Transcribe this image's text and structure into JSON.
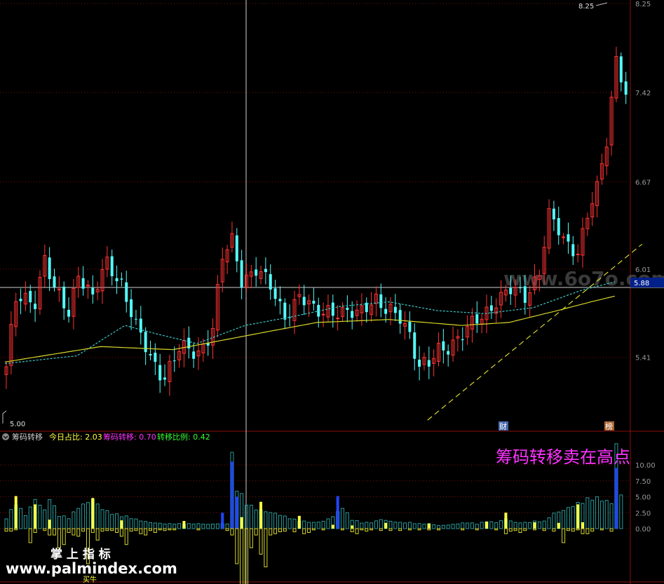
{
  "main": {
    "price_ticks": [
      "8.25",
      "7.42",
      "6.67",
      "6.01",
      "5.41"
    ],
    "current_price": "5.88",
    "high_label": "8.25",
    "low_label": "5.00",
    "badge_cai": "财",
    "badge_bang": "榜",
    "watermark": "www.6o7o.com"
  },
  "sub": {
    "title": "筹码转移",
    "legend_1": "今日占比: 2.03",
    "legend_2": "筹码转移: 0.70",
    "legend_3": "转移比例: 0.42",
    "annotation": "筹码转移卖在高点",
    "ticks": [
      "10.00",
      "7.50",
      "5.00",
      "2.50",
      "0.00"
    ],
    "logo_title": "掌 上 指 标",
    "site": "www.palmindex.com",
    "bottom_label": "买牛"
  },
  "colors": {
    "up": "#ff3232",
    "down": "#54fcfc",
    "ma_short": "#3ec8c8",
    "ma_long": "#d6d62a",
    "yellow": "#ffff44",
    "blue": "#2244ff",
    "magenta": "#ff33ff",
    "green": "#33ff33",
    "axis_highlight": "#00208a"
  },
  "chart_data": [
    {
      "type": "candlestick",
      "y_scale": "log",
      "y_ticks": [
        8.25,
        7.42,
        6.67,
        6.01,
        5.41
      ],
      "ylim": [
        5.0,
        8.25
      ],
      "current_price": 5.88,
      "n_bars": 130,
      "anchors_close": [
        [
          0,
          5.35
        ],
        [
          2,
          5.78
        ],
        [
          6,
          5.8
        ],
        [
          8,
          6.1
        ],
        [
          10,
          5.85
        ],
        [
          13,
          5.7
        ],
        [
          15,
          6.0
        ],
        [
          18,
          5.8
        ],
        [
          21,
          6.05
        ],
        [
          24,
          5.92
        ],
        [
          27,
          5.6
        ],
        [
          30,
          5.4
        ],
        [
          33,
          5.3
        ],
        [
          36,
          5.45
        ],
        [
          40,
          5.45
        ],
        [
          43,
          5.6
        ],
        [
          45,
          6.08
        ],
        [
          47,
          6.22
        ],
        [
          49,
          5.95
        ],
        [
          52,
          6.0
        ],
        [
          55,
          5.88
        ],
        [
          58,
          5.7
        ],
        [
          61,
          5.8
        ],
        [
          64,
          5.72
        ],
        [
          67,
          5.74
        ],
        [
          70,
          5.68
        ],
        [
          73,
          5.7
        ],
        [
          75,
          5.78
        ],
        [
          77,
          5.8
        ],
        [
          79,
          5.7
        ],
        [
          82,
          5.68
        ],
        [
          84,
          5.58
        ],
        [
          86,
          5.35
        ],
        [
          88,
          5.35
        ],
        [
          90,
          5.45
        ],
        [
          93,
          5.52
        ],
        [
          96,
          5.58
        ],
        [
          99,
          5.68
        ],
        [
          102,
          5.8
        ],
        [
          105,
          5.85
        ],
        [
          108,
          5.82
        ],
        [
          111,
          6.0
        ],
        [
          113,
          6.4
        ],
        [
          116,
          6.22
        ],
        [
          119,
          6.15
        ],
        [
          121,
          6.4
        ],
        [
          123,
          6.6
        ],
        [
          125,
          7.0
        ],
        [
          127,
          7.75
        ],
        [
          129,
          7.4
        ]
      ],
      "series": [
        {
          "name": "MA short",
          "anchors": [
            [
              0,
              5.37
            ],
            [
              15,
              5.42
            ],
            [
              25,
              5.62
            ],
            [
              32,
              5.56
            ],
            [
              40,
              5.5
            ],
            [
              50,
              5.62
            ],
            [
              60,
              5.68
            ],
            [
              70,
              5.75
            ],
            [
              80,
              5.78
            ],
            [
              90,
              5.72
            ],
            [
              100,
              5.7
            ],
            [
              110,
              5.74
            ],
            [
              120,
              5.86
            ],
            [
              127,
              5.92
            ]
          ]
        },
        {
          "name": "MA long",
          "anchors": [
            [
              0,
              5.38
            ],
            [
              20,
              5.48
            ],
            [
              35,
              5.46
            ],
            [
              50,
              5.55
            ],
            [
              65,
              5.64
            ],
            [
              80,
              5.66
            ],
            [
              95,
              5.62
            ],
            [
              105,
              5.64
            ],
            [
              115,
              5.72
            ],
            [
              122,
              5.78
            ],
            [
              127,
              5.82
            ]
          ]
        }
      ],
      "trend_line": {
        "from": [
          88,
          5.02
        ],
        "to": [
          129,
          6.13
        ]
      }
    },
    {
      "type": "bar",
      "title": "筹码转移",
      "y_ticks": [
        0.0,
        2.5,
        5.0,
        7.5,
        10.0
      ],
      "ylim": [
        -2.6,
        11.5
      ],
      "legend": [
        {
          "name": "今日占比",
          "value": 2.03
        },
        {
          "name": "筹码转移",
          "value": 0.7
        },
        {
          "name": "转移比例",
          "value": 0.42
        }
      ],
      "positive_anchors": [
        [
          0,
          1.8
        ],
        [
          2,
          4.2
        ],
        [
          4,
          2.2
        ],
        [
          6,
          4.8
        ],
        [
          8,
          3.0
        ],
        [
          9,
          5.0
        ],
        [
          11,
          2.2
        ],
        [
          13,
          1.8
        ],
        [
          15,
          3.5
        ],
        [
          18,
          4.8
        ],
        [
          20,
          3.2
        ],
        [
          22,
          2.5
        ],
        [
          25,
          2.0
        ],
        [
          28,
          1.3
        ],
        [
          30,
          1.0
        ],
        [
          33,
          0.8
        ],
        [
          36,
          0.8
        ],
        [
          38,
          0.8
        ],
        [
          40,
          0.8
        ],
        [
          42,
          0.7
        ],
        [
          44,
          0.8
        ],
        [
          46,
          0.8
        ],
        [
          47,
          12.0
        ],
        [
          48,
          6.8
        ],
        [
          50,
          4.2
        ],
        [
          52,
          3.2
        ],
        [
          54,
          2.8
        ],
        [
          56,
          2.5
        ],
        [
          58,
          2.0
        ],
        [
          60,
          1.5
        ],
        [
          62,
          1.2
        ],
        [
          64,
          1.0
        ],
        [
          66,
          1.2
        ],
        [
          68,
          2.0
        ],
        [
          70,
          3.5
        ],
        [
          72,
          1.5
        ],
        [
          74,
          1.0
        ],
        [
          76,
          1.0
        ],
        [
          78,
          1.5
        ],
        [
          80,
          1.2
        ],
        [
          82,
          1.0
        ],
        [
          84,
          1.0
        ],
        [
          86,
          0.8
        ],
        [
          88,
          0.8
        ],
        [
          90,
          0.5
        ],
        [
          92,
          0.6
        ],
        [
          94,
          0.8
        ],
        [
          96,
          1.0
        ],
        [
          98,
          0.8
        ],
        [
          100,
          1.2
        ],
        [
          102,
          1.0
        ],
        [
          104,
          1.6
        ],
        [
          106,
          1.0
        ],
        [
          108,
          1.0
        ],
        [
          110,
          1.2
        ],
        [
          112,
          1.2
        ],
        [
          114,
          2.5
        ],
        [
          116,
          3.0
        ],
        [
          118,
          3.8
        ],
        [
          120,
          4.5
        ],
        [
          122,
          5.2
        ],
        [
          124,
          4.8
        ],
        [
          126,
          4.2
        ],
        [
          127,
          13.8
        ],
        [
          128,
          5.5
        ]
      ],
      "yellow_bars": [
        [
          2,
          5.1
        ],
        [
          6,
          3.8
        ],
        [
          9,
          1.4
        ],
        [
          18,
          4.8
        ],
        [
          24,
          1.3
        ],
        [
          37,
          1.2
        ],
        [
          49,
          1.8
        ],
        [
          53,
          4.2
        ],
        [
          61,
          2.0
        ],
        [
          68,
          0.6
        ],
        [
          72,
          0.5
        ],
        [
          79,
          0.9
        ],
        [
          88,
          0.8
        ],
        [
          100,
          1.1
        ],
        [
          104,
          2.5
        ],
        [
          110,
          1.0
        ],
        [
          115,
          0.9
        ],
        [
          119,
          3.8
        ],
        [
          120,
          1.0
        ]
      ],
      "blue_bars": [
        [
          45,
          2.5
        ],
        [
          47,
          10.5
        ],
        [
          48,
          5.0
        ],
        [
          69,
          5.1
        ],
        [
          127,
          9.5
        ]
      ],
      "negative_anchors": [
        [
          0,
          -0.4
        ],
        [
          1,
          -0.4
        ],
        [
          2,
          -0.2
        ],
        [
          5,
          -2.2
        ],
        [
          6,
          -0.6
        ],
        [
          8,
          -0.3
        ],
        [
          9,
          -1.0
        ],
        [
          10,
          -1.0
        ],
        [
          11,
          -3.0
        ],
        [
          12,
          -2.5
        ],
        [
          13,
          -0.6
        ],
        [
          14,
          -1.0
        ],
        [
          15,
          -1.2
        ],
        [
          16,
          -0.4
        ],
        [
          17,
          -5.5
        ],
        [
          18,
          -0.6
        ],
        [
          19,
          -1.8
        ],
        [
          20,
          -0.4
        ],
        [
          21,
          -0.3
        ],
        [
          22,
          -0.3
        ],
        [
          23,
          -0.6
        ],
        [
          24,
          -1.2
        ],
        [
          25,
          -2.5
        ],
        [
          26,
          -0.4
        ],
        [
          27,
          -0.3
        ],
        [
          28,
          -0.8
        ],
        [
          29,
          -1.0
        ],
        [
          30,
          -0.3
        ],
        [
          31,
          -0.6
        ],
        [
          32,
          -0.2
        ],
        [
          33,
          -0.3
        ],
        [
          34,
          -0.2
        ],
        [
          35,
          -0.2
        ],
        [
          40,
          -0.2
        ],
        [
          46,
          -0.3
        ],
        [
          47,
          -1.0
        ],
        [
          48,
          -5.5
        ],
        [
          49,
          -11.5
        ],
        [
          50,
          -11.5
        ],
        [
          51,
          -3.0
        ],
        [
          52,
          -1.0
        ],
        [
          53,
          -4.0
        ],
        [
          54,
          -6.0
        ],
        [
          55,
          -1.0
        ],
        [
          56,
          -0.8
        ],
        [
          57,
          -0.5
        ],
        [
          58,
          -0.4
        ],
        [
          60,
          -0.5
        ],
        [
          62,
          -0.8
        ],
        [
          63,
          -0.6
        ],
        [
          64,
          -0.2
        ],
        [
          66,
          -0.2
        ],
        [
          70,
          -0.2
        ],
        [
          72,
          -0.5
        ],
        [
          73,
          -0.8
        ],
        [
          74,
          -0.2
        ],
        [
          75,
          -0.4
        ],
        [
          76,
          -0.2
        ],
        [
          78,
          -0.3
        ],
        [
          80,
          -0.3
        ],
        [
          82,
          -0.3
        ],
        [
          84,
          -0.2
        ],
        [
          86,
          -0.2
        ],
        [
          88,
          -0.2
        ],
        [
          90,
          -0.2
        ],
        [
          95,
          -0.2
        ],
        [
          98,
          -0.2
        ],
        [
          102,
          -0.2
        ],
        [
          104,
          -0.8
        ],
        [
          105,
          -0.4
        ],
        [
          106,
          -0.3
        ],
        [
          107,
          -0.6
        ],
        [
          108,
          -0.3
        ],
        [
          110,
          -0.2
        ],
        [
          112,
          -0.3
        ],
        [
          114,
          -0.4
        ],
        [
          116,
          -2.2
        ],
        [
          117,
          -0.3
        ],
        [
          118,
          -0.4
        ],
        [
          119,
          -0.2
        ],
        [
          120,
          -0.8
        ],
        [
          121,
          -0.8
        ],
        [
          122,
          -0.4
        ],
        [
          124,
          -0.2
        ],
        [
          126,
          -0.4
        ]
      ]
    }
  ]
}
